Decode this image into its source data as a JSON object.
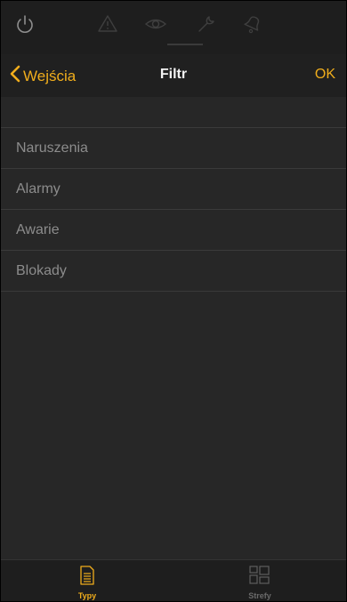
{
  "colors": {
    "accent": "#f0ad1c",
    "background": "#272727",
    "bar_background": "#1e1e1e",
    "list_text": "#8c8c8c",
    "title_text": "#f2f2f2",
    "inactive_icon": "#3f3f3f"
  },
  "top_icons": [
    "power-icon",
    "warning-icon",
    "eye-icon",
    "wrench-icon",
    "bell-icon"
  ],
  "nav": {
    "back_label": "Wejścia",
    "title": "Filtr",
    "ok_label": "OK"
  },
  "list": {
    "items": [
      {
        "label": "Naruszenia"
      },
      {
        "label": "Alarmy"
      },
      {
        "label": "Awarie"
      },
      {
        "label": "Blokady"
      }
    ]
  },
  "tabs": [
    {
      "label": "Typy",
      "icon": "document-icon",
      "active": true
    },
    {
      "label": "Strefy",
      "icon": "grid-icon",
      "active": false
    }
  ]
}
